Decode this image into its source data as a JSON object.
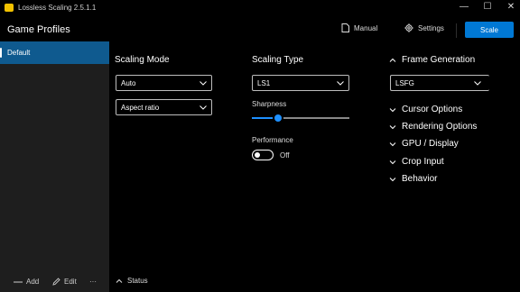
{
  "titlebar": {
    "app_title": "Lossless Scaling 2.5.1.1",
    "minimize": "—",
    "maximize": "☐",
    "close": "✕"
  },
  "header": {
    "page_title": "Game Profiles",
    "manual_label": "Manual",
    "settings_label": "Settings",
    "scale_label": "Scale"
  },
  "sidebar": {
    "profiles": [
      {
        "label": "Default",
        "selected": true
      }
    ],
    "add_label": "Add",
    "edit_label": "Edit",
    "more_label": "···"
  },
  "scaling_mode": {
    "title": "Scaling Mode",
    "mode_value": "Auto",
    "aspect_value": "Aspect ratio"
  },
  "scaling_type": {
    "title": "Scaling Type",
    "type_value": "LS1",
    "sharpness_label": "Sharpness",
    "sharpness_level": 0.27,
    "performance_label": "Performance",
    "performance_state": "Off"
  },
  "frame_generation": {
    "title": "Frame Generation",
    "value": "LSFG"
  },
  "expanders": [
    {
      "label": "Cursor Options"
    },
    {
      "label": "Rendering Options"
    },
    {
      "label": "GPU / Display"
    },
    {
      "label": "Crop Input"
    },
    {
      "label": "Behavior"
    }
  ],
  "status": {
    "label": "Status"
  },
  "colors": {
    "accent": "#0078d4",
    "selected": "#0f5a8f",
    "sidebar": "#1e1e1e",
    "background": "#000000"
  }
}
